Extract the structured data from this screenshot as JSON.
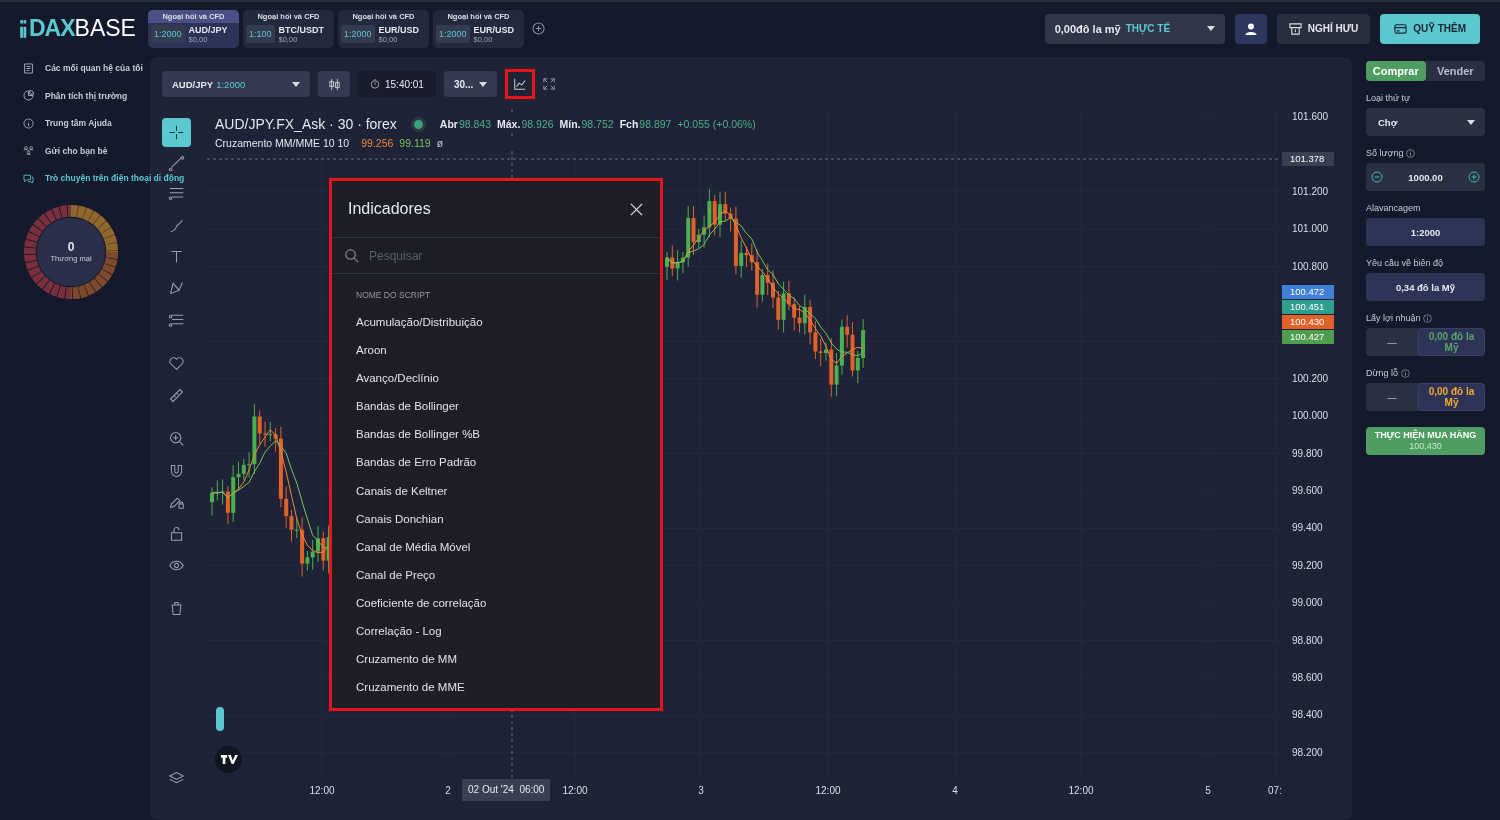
{
  "header": {
    "logo": {
      "accent": "DAX",
      "rest": "BASE"
    },
    "instruments": [
      {
        "category": "Ngoại hối và CFD",
        "leverage": "1:2000",
        "symbol": "AUD/JPY",
        "balance": "$0,00",
        "selected": true
      },
      {
        "category": "Ngoại hối và CFD",
        "leverage": "1:100",
        "symbol": "BTC/USDT",
        "balance": "$0,00",
        "selected": false
      },
      {
        "category": "Ngoại hối và CFD",
        "leverage": "1:2000",
        "symbol": "EUR/USD",
        "balance": "$0,00",
        "selected": false
      },
      {
        "category": "Ngoại hối và CFD",
        "leverage": "1:2000",
        "symbol": "EUR/USD",
        "balance": "$0,00",
        "selected": false
      }
    ],
    "account": {
      "balance": "0,00đô la mỹ",
      "mode": "THỰC TẾ"
    },
    "buttons": [
      {
        "kind": "withdraw",
        "label": "NGHỈ HƯU"
      },
      {
        "kind": "deposit",
        "label": "QUỸ THÊM"
      }
    ]
  },
  "sidebar": {
    "items": [
      {
        "label": "Các mối quan hệ của tôi",
        "selected": false
      },
      {
        "label": "Phân tích thị trường",
        "selected": false
      },
      {
        "label": "Trung tâm Ajuda",
        "selected": false
      },
      {
        "label": "Gửi cho bạn bè",
        "selected": false
      },
      {
        "label": "Trò chuyện trên điện thoại di động",
        "selected": true
      }
    ],
    "gauge": {
      "value": "0",
      "label": "Thương mại"
    }
  },
  "chart": {
    "toolbar": {
      "symbol": "AUD/JPY",
      "leverage": "1:2000",
      "time": "15:40:01",
      "interval": "30...",
      "indicators_highlighted": true
    },
    "legend": {
      "title": "AUD/JPY.FX_Ask · 30 · forex",
      "stats": [
        {
          "label": "Abr",
          "value": "98.843"
        },
        {
          "label": "Máx.",
          "value": "98.926"
        },
        {
          "label": "Mín.",
          "value": "98.752"
        },
        {
          "label": "Fch",
          "value": "98.897"
        }
      ],
      "change": "+0.055 (+0.06%)",
      "study": "Cruzamento MM/MME 10 10",
      "study_values": [
        {
          "value": "99.256",
          "color": "#f0883e"
        },
        {
          "value": "99.119",
          "color": "#7cc35a"
        }
      ],
      "study_extra": "ø"
    },
    "price_axis": [
      "101.600",
      "101.200",
      "101.000",
      "100.800",
      "100.200",
      "100.000",
      "99.800",
      "99.600",
      "99.400",
      "99.200",
      "99.000",
      "98.800",
      "98.600",
      "98.400",
      "98.200"
    ],
    "price_tags": [
      {
        "value": "101.378",
        "color": "#3a3f52"
      },
      {
        "value": "100.472",
        "color": "#3f7fd6"
      },
      {
        "value": "100.451",
        "color": "#2f9e8f"
      },
      {
        "value": "100.430",
        "color": "#e0612a"
      },
      {
        "value": "100.427",
        "color": "#4f9d4f"
      }
    ],
    "time_axis": [
      "12:00",
      "2",
      "12:00",
      "3",
      "12:00",
      "4",
      "12:00",
      "5",
      "07:"
    ],
    "crosshair_time": "02 Out '24  06:00",
    "indicators_dialog": {
      "title": "Indicadores",
      "highlighted": true,
      "search": {
        "placeholder": "Pesquisar"
      },
      "section": "NOME DO SCRIPT",
      "items": [
        "Acumulação/Distribuição",
        "Aroon",
        "Avanço/Declínio",
        "Bandas de Bollinger",
        "Bandas de Bollinger %B",
        "Bandas de Erro Padrão",
        "Canais de Keltner",
        "Canais Donchian",
        "Canal de Média Móvel",
        "Canal de Preço",
        "Coeficiente de correlação",
        "Correlação - Log",
        "Cruzamento de MM",
        "Cruzamento de MME"
      ]
    }
  },
  "order": {
    "sides": [
      {
        "label": "Comprar",
        "selected": true
      },
      {
        "label": "Vender",
        "selected": false
      }
    ],
    "fields": [
      {
        "kind": "select",
        "label": "Loại thứ tự",
        "value": "Chợ"
      },
      {
        "kind": "stepper",
        "label": "Số lượng",
        "info": true,
        "value": "1000.00"
      },
      {
        "kind": "display",
        "label": "Alavancagem",
        "value": "1:2000"
      },
      {
        "kind": "display",
        "label": "Yêu cầu về biên độ",
        "value": "0,34 đô la Mỹ"
      },
      {
        "kind": "toggle",
        "label": "Lấy lợi nhuận",
        "info": true,
        "off_label": "—",
        "value": "0,00 đô la Mỹ",
        "color": "#5aa469"
      },
      {
        "kind": "toggle",
        "label": "Dừng lỗ",
        "info": true,
        "off_label": "—",
        "value": "0,00 đô la Mỹ",
        "color": "#f0a830"
      }
    ],
    "submit": {
      "label": "THỰC HIỆN MUA HÀNG",
      "price": "100,430"
    }
  }
}
